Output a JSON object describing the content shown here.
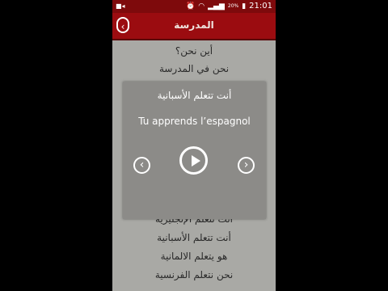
{
  "status_bar": {
    "battery": "20%",
    "time": "21:01",
    "icons": [
      "video-icon",
      "alarm-icon",
      "wifi-icon",
      "signal-icon",
      "battery-icon"
    ]
  },
  "app_bar": {
    "title": "المدرسة",
    "back_icon": "chevron-left-icon"
  },
  "phrases": [
    "أين نحن؟",
    "نحن في المدرسة",
    "أنت تتعلم الإنجليزية",
    "أنت تتعلم الأسبانية",
    "هو يتعلم الالمانية",
    "نحن نتعلم الفرنسية"
  ],
  "dialog": {
    "arabic": "أنت تتعلم الأسبانية",
    "french": "Tu apprends l’espagnol",
    "prev_icon": "chevron-left-icon",
    "play_icon": "play-icon",
    "next_icon": "chevron-right-icon"
  },
  "colors": {
    "app_bar": "#9b0c10",
    "background": "#a9a9a5",
    "dialog": "#8c8b88"
  }
}
